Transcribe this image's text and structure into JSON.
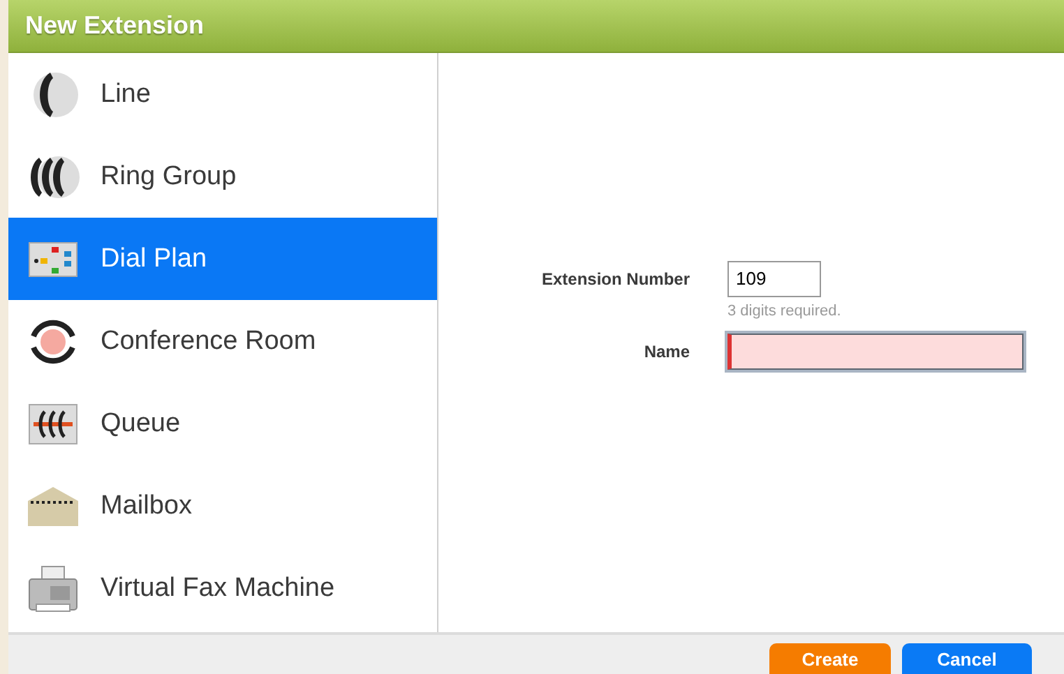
{
  "window": {
    "title": "New Extension"
  },
  "sidebar": {
    "items": [
      {
        "label": "Line",
        "selected": false
      },
      {
        "label": "Ring Group",
        "selected": false
      },
      {
        "label": "Dial Plan",
        "selected": true
      },
      {
        "label": "Conference Room",
        "selected": false
      },
      {
        "label": "Queue",
        "selected": false
      },
      {
        "label": "Mailbox",
        "selected": false
      },
      {
        "label": "Virtual Fax Machine",
        "selected": false
      }
    ]
  },
  "form": {
    "fields": [
      {
        "label": "Extension Number",
        "value": "109",
        "hint": "3 digits required.",
        "invalid": false
      },
      {
        "label": "Name",
        "invalid": true
      }
    ]
  },
  "buttons": [
    {
      "label": "Create",
      "kind": "primary"
    },
    {
      "label": "Cancel",
      "kind": "secondary"
    }
  ]
}
